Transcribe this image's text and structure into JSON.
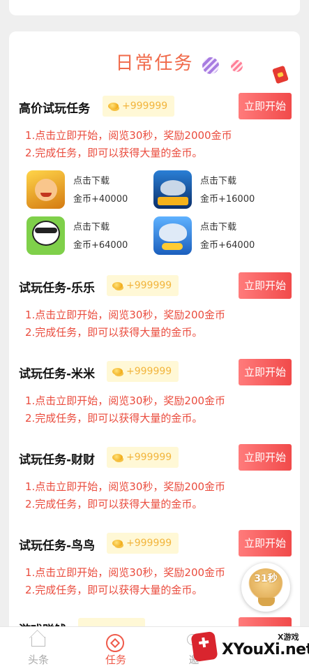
{
  "section_title": "日常任务",
  "featured_task": {
    "title": "高价试玩任务",
    "reward": "+999999",
    "button": "立即开始",
    "desc": [
      "1.点击立即开始，阅览30秒，奖励2000金币",
      "2.完成任务，即可以获得大量的金币。"
    ],
    "apps": [
      {
        "icon": "lucky-god-game-icon",
        "label": "点击下载",
        "coins": "金币+40000"
      },
      {
        "icon": "shark-fishing-game-icon",
        "label": "点击下载",
        "coins": "金币+16000"
      },
      {
        "icon": "panda-game-icon",
        "label": "点击下载",
        "coins": "金币+64000"
      },
      {
        "icon": "shark-coins-game-icon",
        "label": "点击下载",
        "coins": "金币+64000"
      }
    ]
  },
  "tasks": [
    {
      "title": "试玩任务-乐乐",
      "reward": "+999999",
      "button": "立即开始",
      "desc": [
        "1.点击立即开始，阅览30秒，奖励200金币",
        "2.完成任务，即可以获得大量的金币。"
      ]
    },
    {
      "title": "试玩任务-米米",
      "reward": "+999999",
      "button": "立即开始",
      "desc": [
        "1.点击立即开始，阅览30秒，奖励200金币",
        "2.完成任务，即可以获得大量的金币。"
      ]
    },
    {
      "title": "试玩任务-财财",
      "reward": "+999999",
      "button": "立即开始",
      "desc": [
        "1.点击立即开始，阅览30秒，奖励200金币",
        "2.完成任务，即可以获得大量的金币。"
      ]
    },
    {
      "title": "试玩任务-鸟鸟",
      "reward": "+999999",
      "button": "立即开始",
      "desc": [
        "1.点击立即开始，阅览30秒，奖励200金币",
        "2.完成任务，即可以获得大量的金币。"
      ]
    }
  ],
  "next_task_title": "游戏赚钱",
  "float_widget": {
    "timer": "31秒"
  },
  "tabbar": {
    "home": "头条",
    "task": "任务",
    "invite": "邀"
  },
  "watermark": {
    "sub": "X游戏",
    "text": "XYouXi.net"
  },
  "colors": {
    "accent": "#ef5a4a",
    "title": "#f06a4a",
    "reward_text": "#f2b53d"
  }
}
